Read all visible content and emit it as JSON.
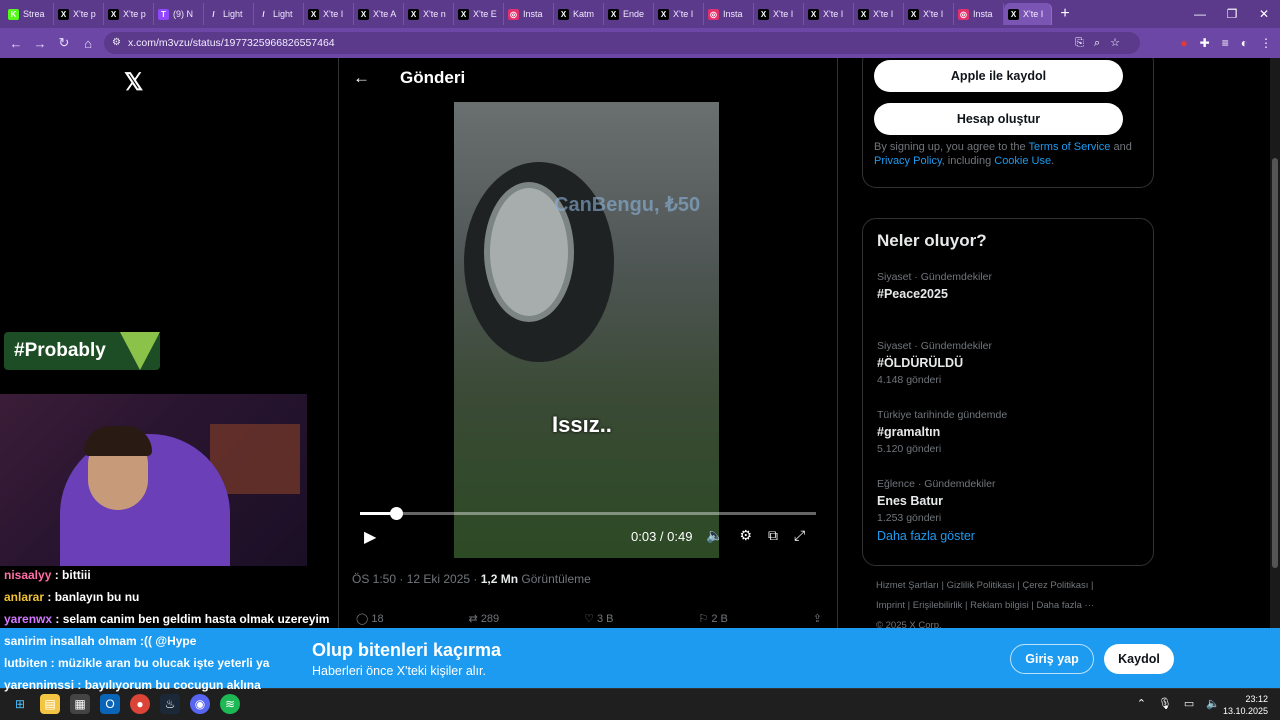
{
  "browser": {
    "tabs": [
      {
        "label": "Strea",
        "fav": "K",
        "color": "#53fc18"
      },
      {
        "label": "X'te p",
        "fav": "X",
        "color": "#000000"
      },
      {
        "label": "X'te p",
        "fav": "X",
        "color": "#000000"
      },
      {
        "label": "(9) N",
        "fav": "T",
        "color": "#9146ff"
      },
      {
        "label": "Light",
        "fav": "/",
        "color": "#5b3a8c"
      },
      {
        "label": "Light",
        "fav": "/",
        "color": "#5b3a8c"
      },
      {
        "label": "X'te I",
        "fav": "X",
        "color": "#000000"
      },
      {
        "label": "X'te A",
        "fav": "X",
        "color": "#000000"
      },
      {
        "label": "X'te n",
        "fav": "X",
        "color": "#000000"
      },
      {
        "label": "X'te E",
        "fav": "X",
        "color": "#000000"
      },
      {
        "label": "Insta",
        "fav": "◎",
        "color": "#e1306c"
      },
      {
        "label": "Katm",
        "fav": "X",
        "color": "#000000"
      },
      {
        "label": "Ende",
        "fav": "X",
        "color": "#000000"
      },
      {
        "label": "X'te I",
        "fav": "X",
        "color": "#000000"
      },
      {
        "label": "Insta",
        "fav": "◎",
        "color": "#e1306c"
      },
      {
        "label": "X'te I",
        "fav": "X",
        "color": "#000000"
      },
      {
        "label": "X'te I",
        "fav": "X",
        "color": "#000000"
      },
      {
        "label": "X'te I",
        "fav": "X",
        "color": "#000000"
      },
      {
        "label": "X'te I",
        "fav": "X",
        "color": "#000000"
      },
      {
        "label": "Insta",
        "fav": "◎",
        "color": "#e1306c"
      },
      {
        "label": "X'te I",
        "fav": "X",
        "color": "#000000"
      }
    ],
    "url": "x.com/m3vzu/status/1977325966826557464"
  },
  "page": {
    "header_title": "Gönderi",
    "video": {
      "watermark": "CanBengu, ₺50",
      "subtitle": "Issız..",
      "time": "0:03 / 0:49",
      "progress": 0.08
    },
    "meta": {
      "time": "ÖS 1:50 · 12 Eki 2025 · ",
      "views": "1,2 Mn",
      "views_label": " Görüntüleme"
    },
    "actions": {
      "replies": "18",
      "reposts": "289",
      "likes": "3 B",
      "bookmarks": "2 B"
    }
  },
  "sidebar": {
    "apple_label": "Apple ile kaydol",
    "create_label": "Hesap oluştur",
    "terms_prefix": "By signing up, you agree to the ",
    "terms_link": "Terms of Service",
    "terms_mid": " and ",
    "privacy_link": "Privacy Policy",
    "terms_mid2": ", including ",
    "cookie_link": "Cookie Use",
    "terms_end": ".",
    "trends_title": "Neler oluyor?",
    "trends": [
      {
        "cat": "Siyaset · Gündemdekiler",
        "name": "#Peace2025",
        "count": ""
      },
      {
        "cat": "Siyaset · Gündemdekiler",
        "name": "#ÖLDÜRÜLDÜ",
        "count": "4.148 gönderi"
      },
      {
        "cat": "Türkiye tarihinde gündemde",
        "name": "#gramaltın",
        "count": "5.120 gönderi"
      },
      {
        "cat": "Eğlence · Gündemdekiler",
        "name": "Enes Batur",
        "count": "1.253 gönderi"
      }
    ],
    "show_more": "Daha fazla göster",
    "footer_line1": "Hizmet Şartları  |  Gizlilik Politikası  |  Çerez Politikası  |",
    "footer_line2": "Imprint  |  Erişilebilirlik  |  Reklam bilgisi  |  Daha fazla ···",
    "footer_line3": "© 2025 X Corp."
  },
  "stream": {
    "badge": "#Probably",
    "chat": [
      {
        "user": "nisaalyy",
        "msg": " : bittiii",
        "cls": "u1"
      },
      {
        "user": "anlarar",
        "msg": " : banlayın bu nu",
        "cls": "u2"
      },
      {
        "user": "yarenwx",
        "msg": " : selam canim ben geldim hasta olmak uzereyim",
        "cls": "u3"
      }
    ],
    "chat2": [
      {
        "user": "",
        "msg": "sanirim insallah olmam :(( @Hype",
        "cls": ""
      },
      {
        "user": "lutbiten",
        "msg": " : müzikle aran bu olucak işte yeterli ya",
        "cls": "u4"
      },
      {
        "user": "yarennimssi",
        "msg": " : bayılıyorum bu cocugun aklına",
        "cls": "u3"
      }
    ]
  },
  "banner": {
    "title": "Olup bitenleri kaçırma",
    "subtitle": "Haberleri önce X'teki kişiler alır.",
    "login": "Giriş yap",
    "register": "Kaydol"
  },
  "taskbar": {
    "time": "23:12",
    "date": "13.10.2025"
  }
}
